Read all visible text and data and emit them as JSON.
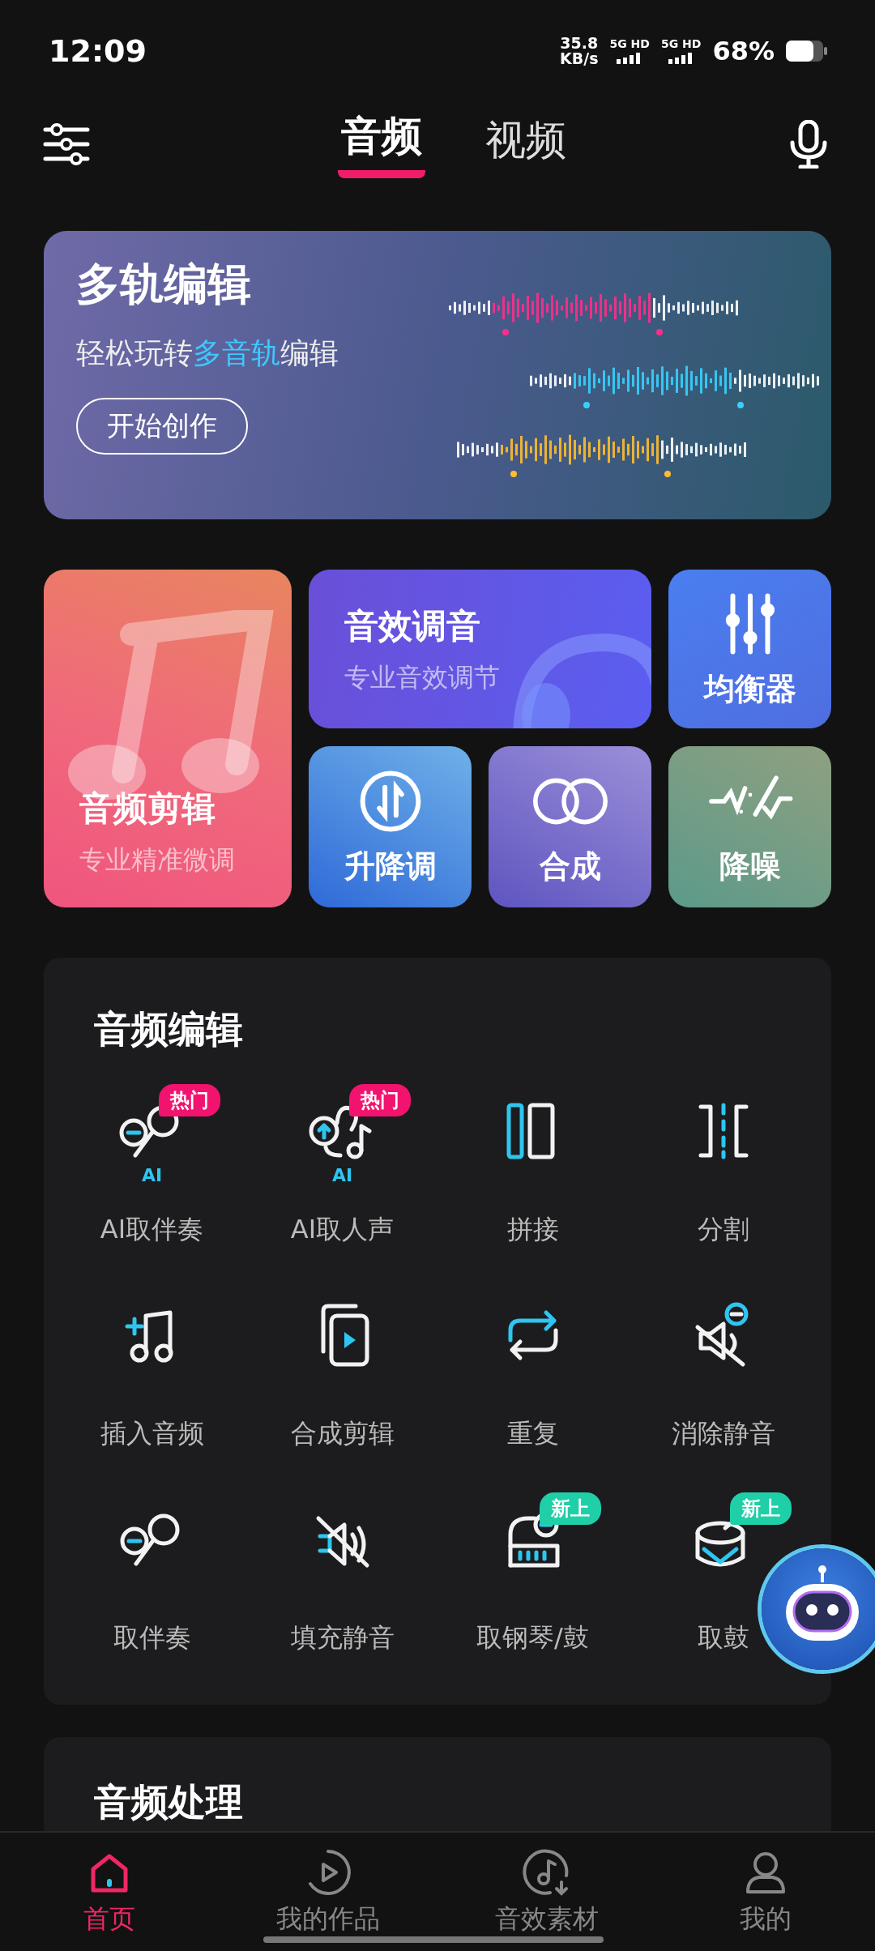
{
  "status_bar": {
    "time": "12:09",
    "speed_value": "35.8",
    "speed_unit": "KB/s",
    "signals": [
      "5G HD",
      "5G HD"
    ],
    "battery": "68%"
  },
  "header": {
    "tabs": [
      {
        "label": "音频",
        "selected": true
      },
      {
        "label": "视频",
        "selected": false
      }
    ]
  },
  "banner": {
    "title": "多轨编辑",
    "subtitle": [
      {
        "text": "轻松玩转",
        "highlight": false
      },
      {
        "text": "多音轨",
        "highlight": true
      },
      {
        "text": "编辑",
        "highlight": false
      }
    ],
    "button": "开始创作"
  },
  "tiles": [
    {
      "kind": "large",
      "title": "音频剪辑",
      "subtitle": "专业精准微调"
    },
    {
      "kind": "wide",
      "title": "音效调音",
      "subtitle": "专业音效调节"
    },
    {
      "kind": "small",
      "title": "均衡器"
    },
    {
      "kind": "small",
      "title": "升降调"
    },
    {
      "kind": "small",
      "title": "合成"
    },
    {
      "kind": "small",
      "title": "降噪"
    }
  ],
  "audio_edit": {
    "title": "音频编辑",
    "items": [
      {
        "label": "AI取伴奏",
        "ai_tag": "AI",
        "badge": {
          "text": "热门",
          "color": "#f2136e"
        }
      },
      {
        "label": "AI取人声",
        "ai_tag": "AI",
        "badge": {
          "text": "热门",
          "color": "#f2136e"
        }
      },
      {
        "label": "拼接"
      },
      {
        "label": "分割"
      },
      {
        "label": "插入音频"
      },
      {
        "label": "合成剪辑"
      },
      {
        "label": "重复"
      },
      {
        "label": "消除静音"
      },
      {
        "label": "取伴奏"
      },
      {
        "label": "填充静音"
      },
      {
        "label": "取钢琴/鼓",
        "badge": {
          "text": "新上",
          "color": "#1fcfa8"
        }
      },
      {
        "label": "取鼓",
        "badge": {
          "text": "新上",
          "color": "#1fcfa8"
        }
      }
    ]
  },
  "audio_process": {
    "title": "音频处理"
  },
  "bottom_nav": [
    {
      "label": "首页",
      "selected": true
    },
    {
      "label": "我的作品",
      "selected": false
    },
    {
      "label": "音效素材",
      "selected": false
    },
    {
      "label": "我的",
      "selected": false
    }
  ]
}
